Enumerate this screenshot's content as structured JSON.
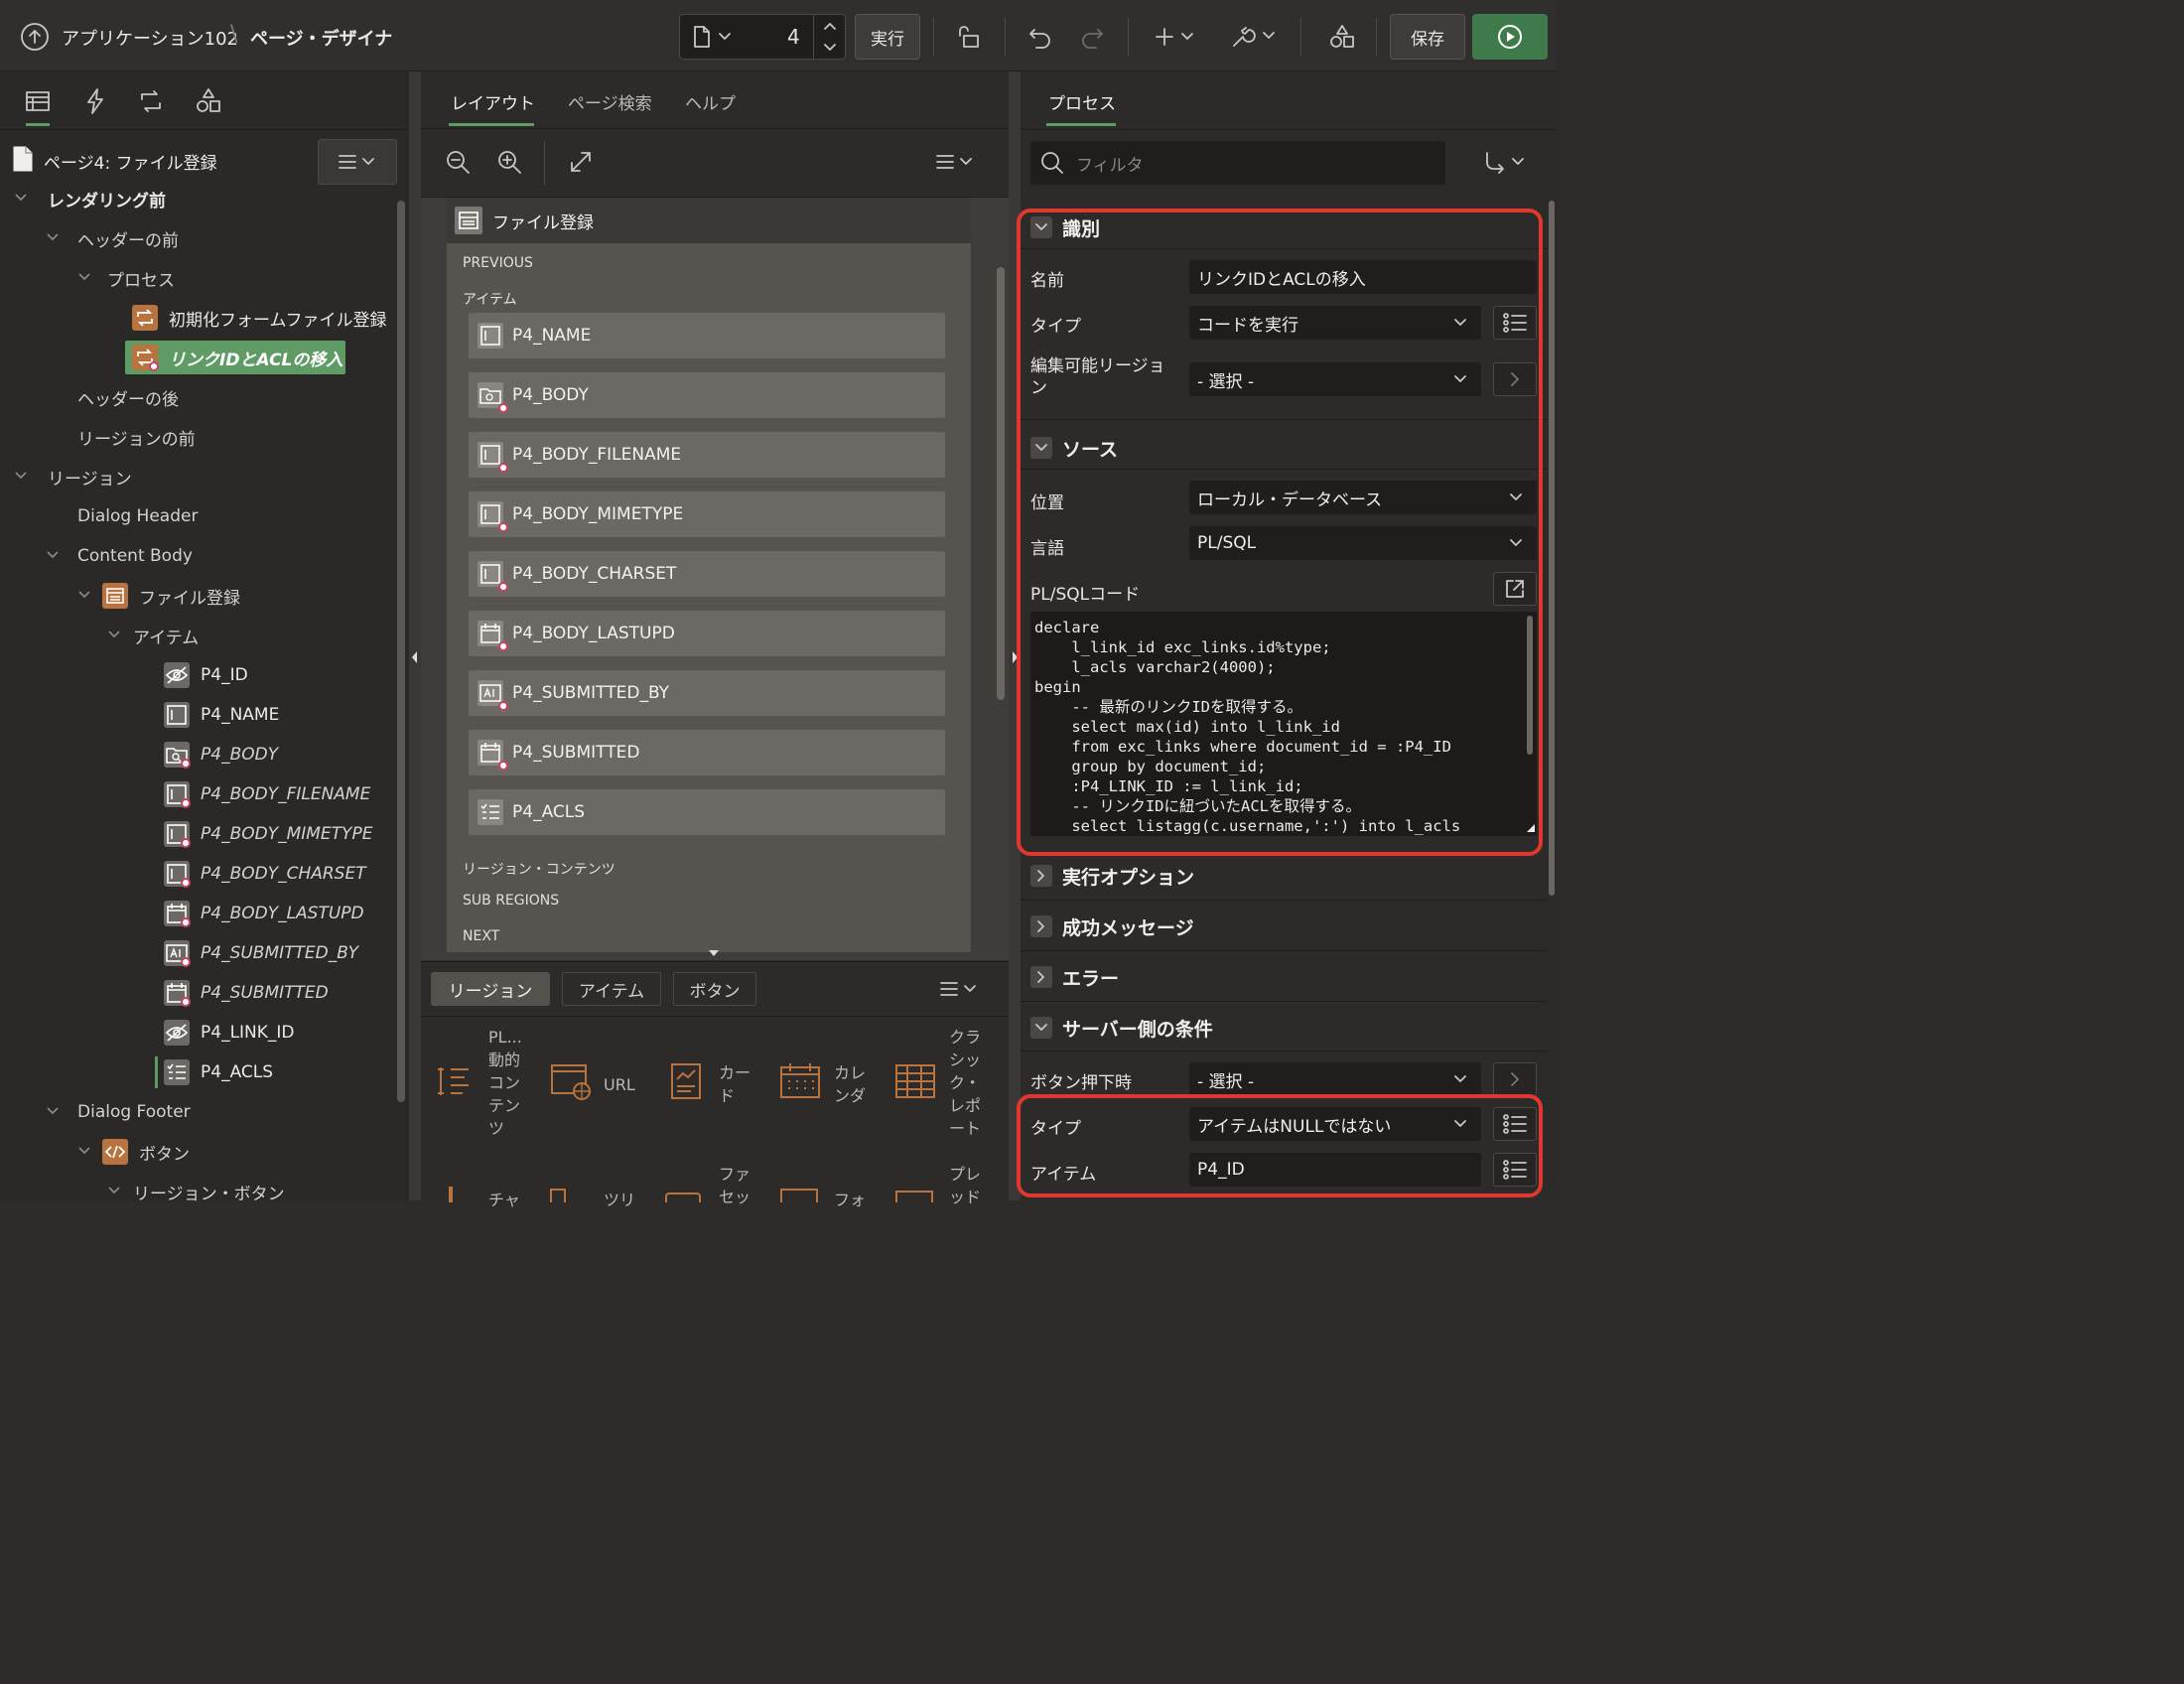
{
  "topbar": {
    "app_title": "アプリケーション102",
    "separator": "\\",
    "page_designer": "ページ・デザイナ",
    "page_number": "4",
    "run_label": "実行",
    "save_label": "保存"
  },
  "left": {
    "page_title": "ページ4: ファイル登録",
    "tree": [
      {
        "label": "レンダリング前",
        "level": 0,
        "bold": true
      },
      {
        "label": "ヘッダーの前",
        "level": 1
      },
      {
        "label": "プロセス",
        "level": 2
      },
      {
        "label": "初期化フォームファイル登録",
        "level": 3,
        "icon": "process"
      },
      {
        "label": "リンクIDとACLの移入",
        "level": 3,
        "icon": "process",
        "selected": true
      },
      {
        "label": "ヘッダーの後",
        "level": 1
      },
      {
        "label": "リージョンの前",
        "level": 1
      },
      {
        "label": "リージョン",
        "level": 0
      },
      {
        "label": "Dialog Header",
        "level": 1
      },
      {
        "label": "Content Body",
        "level": 1
      },
      {
        "label": "ファイル登録",
        "level": 2,
        "icon": "region"
      },
      {
        "label": "アイテム",
        "level": 3
      },
      {
        "label": "P4_ID",
        "level": 4,
        "icon": "hidden"
      },
      {
        "label": "P4_NAME",
        "level": 4,
        "icon": "text"
      },
      {
        "label": "P4_BODY",
        "level": 4,
        "icon": "file",
        "italic": true
      },
      {
        "label": "P4_BODY_FILENAME",
        "level": 4,
        "icon": "text",
        "italic": true
      },
      {
        "label": "P4_BODY_MIMETYPE",
        "level": 4,
        "icon": "text",
        "italic": true
      },
      {
        "label": "P4_BODY_CHARSET",
        "level": 4,
        "icon": "text",
        "italic": true
      },
      {
        "label": "P4_BODY_LASTUPD",
        "level": 4,
        "icon": "date",
        "italic": true
      },
      {
        "label": "P4_SUBMITTED_BY",
        "level": 4,
        "icon": "ai",
        "italic": true
      },
      {
        "label": "P4_SUBMITTED",
        "level": 4,
        "icon": "date",
        "italic": true
      },
      {
        "label": "P4_LINK_ID",
        "level": 4,
        "icon": "hidden"
      },
      {
        "label": "P4_ACLS",
        "level": 4,
        "icon": "list"
      },
      {
        "label": "Dialog Footer",
        "level": 1
      },
      {
        "label": "ボタン",
        "level": 2,
        "icon": "code"
      },
      {
        "label": "リージョン・ボタン",
        "level": 3
      }
    ]
  },
  "middle": {
    "tabs": [
      "レイアウト",
      "ページ検索",
      "ヘルプ"
    ],
    "region_title": "ファイル登録",
    "previous": "PREVIOUS",
    "items_label": "アイテム",
    "items": [
      "P4_NAME",
      "P4_BODY",
      "P4_BODY_FILENAME",
      "P4_BODY_MIMETYPE",
      "P4_BODY_CHARSET",
      "P4_BODY_LASTUPD",
      "P4_SUBMITTED_BY",
      "P4_SUBMITTED",
      "P4_ACLS"
    ],
    "region_contents": "リージョン・コンテンツ",
    "sub_regions": "SUB REGIONS",
    "next": "NEXT",
    "gallery_tabs": [
      "リージョン",
      "アイテム",
      "ボタン"
    ],
    "gallery": [
      "PL...\n動的\nコン\nテン\nツ",
      "URL",
      "カー\nド",
      "カレ\nンダ",
      "クラ\nシッ\nク・\nレポ\nート"
    ],
    "gallery_row2": [
      "チャ",
      "ツリ",
      "ファ\nセッ",
      "フォ",
      "プレ\nッド"
    ]
  },
  "right": {
    "tab": "プロセス",
    "filter_placeholder": "フィルタ",
    "identification": {
      "head": "識別",
      "name_label": "名前",
      "name_value": "リンクIDとACLの移入",
      "type_label": "タイプ",
      "type_value": "コードを実行",
      "region_label": "編集可能リージョ\nン",
      "region_value": "- 選択 -"
    },
    "source": {
      "head": "ソース",
      "location_label": "位置",
      "location_value": "ローカル・データベース",
      "language_label": "言語",
      "language_value": "PL/SQL",
      "code_label": "PL/SQLコード",
      "code": "declare\n    l_link_id exc_links.id%type;\n    l_acls varchar2(4000);\nbegin\n    -- 最新のリンクIDを取得する。\n    select max(id) into l_link_id\n    from exc_links where document_id = :P4_ID\n    group by document_id;\n    :P4_LINK_ID := l_link_id;\n    -- リンクIDに紐づいたACLを取得する。\n    select listagg(c.username,':') into l_acls"
    },
    "exec_options": "実行オプション",
    "success_message": "成功メッセージ",
    "error": "エラー",
    "server_condition": {
      "head": "サーバー側の条件",
      "button_label": "ボタン押下時",
      "button_value": "- 選択 -",
      "type_label": "タイプ",
      "type_value": "アイテムはNULLではない",
      "item_label": "アイテム",
      "item_value": "P4_ID"
    }
  },
  "colors": {
    "accent": "#5f9b65",
    "highlight": "#e0382e",
    "process_icon": "#b8733e",
    "run_button": "#3f7a4a"
  }
}
